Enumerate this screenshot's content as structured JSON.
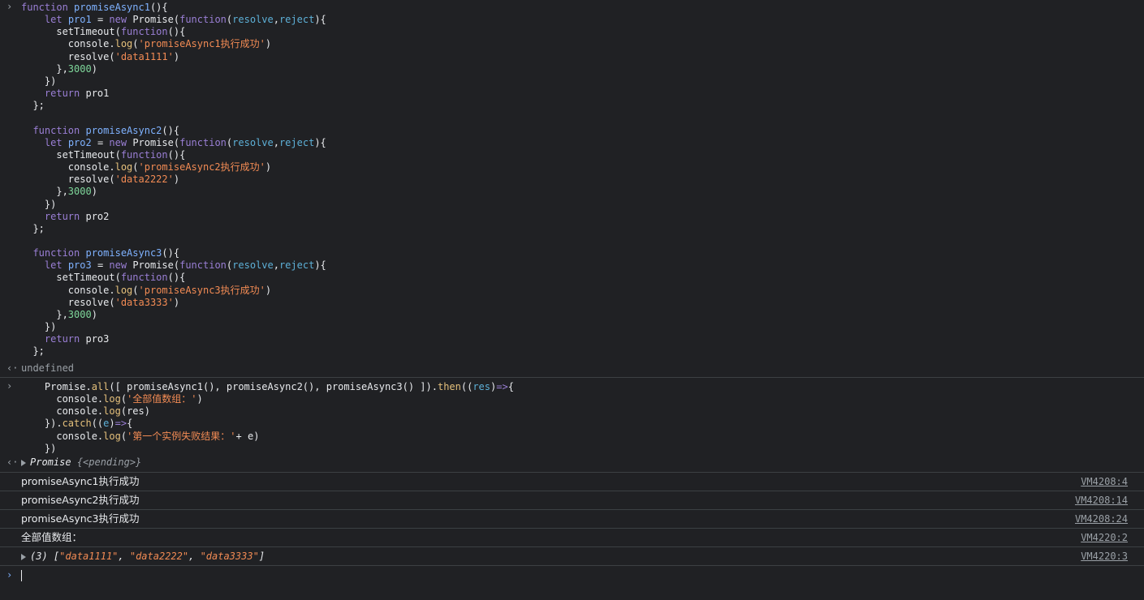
{
  "glyphs": {
    "prompt": "›",
    "result": "‹·"
  },
  "input1": {
    "lines": [
      [
        [
          "kw",
          "function "
        ],
        [
          "fn",
          "promiseAsync1"
        ],
        [
          "prop",
          "(){"
        ]
      ],
      [
        [
          "prop",
          "    "
        ],
        [
          "kw",
          "let "
        ],
        [
          "fn",
          "pro1"
        ],
        [
          "prop",
          " = "
        ],
        [
          "kw",
          "new "
        ],
        [
          "prop",
          "Promise("
        ],
        [
          "kw",
          "function"
        ],
        [
          "prop",
          "("
        ],
        [
          "prm",
          "resolve"
        ],
        [
          "prop",
          ","
        ],
        [
          "prm",
          "reject"
        ],
        [
          "prop",
          "){"
        ]
      ],
      [
        [
          "prop",
          "      setTimeout("
        ],
        [
          "kw",
          "function"
        ],
        [
          "prop",
          "(){"
        ]
      ],
      [
        [
          "prop",
          "        console."
        ],
        [
          "meth",
          "log"
        ],
        [
          "prop",
          "("
        ],
        [
          "str",
          "'promiseAsync1执行成功'"
        ],
        [
          "prop",
          ")"
        ]
      ],
      [
        [
          "prop",
          "        resolve("
        ],
        [
          "str",
          "'data1111'"
        ],
        [
          "prop",
          ")"
        ]
      ],
      [
        [
          "prop",
          "      },"
        ],
        [
          "num",
          "3000"
        ],
        [
          "prop",
          ")"
        ]
      ],
      [
        [
          "prop",
          "    })"
        ]
      ],
      [
        [
          "prop",
          "    "
        ],
        [
          "kw",
          "return "
        ],
        [
          "prop",
          "pro1"
        ]
      ],
      [
        [
          "prop",
          "  };"
        ]
      ],
      [
        [
          "prop",
          ""
        ]
      ],
      [
        [
          "prop",
          "  "
        ],
        [
          "kw",
          "function "
        ],
        [
          "fn",
          "promiseAsync2"
        ],
        [
          "prop",
          "(){"
        ]
      ],
      [
        [
          "prop",
          "    "
        ],
        [
          "kw",
          "let "
        ],
        [
          "fn",
          "pro2"
        ],
        [
          "prop",
          " = "
        ],
        [
          "kw",
          "new "
        ],
        [
          "prop",
          "Promise("
        ],
        [
          "kw",
          "function"
        ],
        [
          "prop",
          "("
        ],
        [
          "prm",
          "resolve"
        ],
        [
          "prop",
          ","
        ],
        [
          "prm",
          "reject"
        ],
        [
          "prop",
          "){"
        ]
      ],
      [
        [
          "prop",
          "      setTimeout("
        ],
        [
          "kw",
          "function"
        ],
        [
          "prop",
          "(){"
        ]
      ],
      [
        [
          "prop",
          "        console."
        ],
        [
          "meth",
          "log"
        ],
        [
          "prop",
          "("
        ],
        [
          "str",
          "'promiseAsync2执行成功'"
        ],
        [
          "prop",
          ")"
        ]
      ],
      [
        [
          "prop",
          "        resolve("
        ],
        [
          "str",
          "'data2222'"
        ],
        [
          "prop",
          ")"
        ]
      ],
      [
        [
          "prop",
          "      },"
        ],
        [
          "num",
          "3000"
        ],
        [
          "prop",
          ")"
        ]
      ],
      [
        [
          "prop",
          "    })"
        ]
      ],
      [
        [
          "prop",
          "    "
        ],
        [
          "kw",
          "return "
        ],
        [
          "prop",
          "pro2"
        ]
      ],
      [
        [
          "prop",
          "  };"
        ]
      ],
      [
        [
          "prop",
          ""
        ]
      ],
      [
        [
          "prop",
          "  "
        ],
        [
          "kw",
          "function "
        ],
        [
          "fn",
          "promiseAsync3"
        ],
        [
          "prop",
          "(){"
        ]
      ],
      [
        [
          "prop",
          "    "
        ],
        [
          "kw",
          "let "
        ],
        [
          "fn",
          "pro3"
        ],
        [
          "prop",
          " = "
        ],
        [
          "kw",
          "new "
        ],
        [
          "prop",
          "Promise("
        ],
        [
          "kw",
          "function"
        ],
        [
          "prop",
          "("
        ],
        [
          "prm",
          "resolve"
        ],
        [
          "prop",
          ","
        ],
        [
          "prm",
          "reject"
        ],
        [
          "prop",
          "){"
        ]
      ],
      [
        [
          "prop",
          "      setTimeout("
        ],
        [
          "kw",
          "function"
        ],
        [
          "prop",
          "(){"
        ]
      ],
      [
        [
          "prop",
          "        console."
        ],
        [
          "meth",
          "log"
        ],
        [
          "prop",
          "("
        ],
        [
          "str",
          "'promiseAsync3执行成功'"
        ],
        [
          "prop",
          ")"
        ]
      ],
      [
        [
          "prop",
          "        resolve("
        ],
        [
          "str",
          "'data3333'"
        ],
        [
          "prop",
          ")"
        ]
      ],
      [
        [
          "prop",
          "      },"
        ],
        [
          "num",
          "3000"
        ],
        [
          "prop",
          ")"
        ]
      ],
      [
        [
          "prop",
          "    })"
        ]
      ],
      [
        [
          "prop",
          "    "
        ],
        [
          "kw",
          "return "
        ],
        [
          "prop",
          "pro3"
        ]
      ],
      [
        [
          "prop",
          "  };"
        ]
      ]
    ]
  },
  "result1": "undefined",
  "input2": {
    "lines": [
      [
        [
          "prop",
          "    Promise."
        ],
        [
          "meth",
          "all"
        ],
        [
          "prop",
          "([ promiseAsync1(), promiseAsync2(), promiseAsync3() ])."
        ],
        [
          "meth",
          "then"
        ],
        [
          "prop",
          "(("
        ],
        [
          "prm",
          "res"
        ],
        [
          "prop",
          ")"
        ],
        [
          "kw",
          "=>"
        ],
        [
          "prop",
          "{"
        ]
      ],
      [
        [
          "prop",
          "      console."
        ],
        [
          "meth",
          "log"
        ],
        [
          "prop",
          "("
        ],
        [
          "str",
          "'全部值数组：'"
        ],
        [
          "prop",
          ")"
        ]
      ],
      [
        [
          "prop",
          "      console."
        ],
        [
          "meth",
          "log"
        ],
        [
          "prop",
          "(res)"
        ]
      ],
      [
        [
          "prop",
          "    })."
        ],
        [
          "meth",
          "catch"
        ],
        [
          "prop",
          "(("
        ],
        [
          "prm",
          "e"
        ],
        [
          "prop",
          ")"
        ],
        [
          "kw",
          "=>"
        ],
        [
          "prop",
          "{"
        ]
      ],
      [
        [
          "prop",
          "      console."
        ],
        [
          "meth",
          "log"
        ],
        [
          "prop",
          "("
        ],
        [
          "str",
          "'第一个实例失败结果：'"
        ],
        [
          "prop",
          "+ e)"
        ]
      ],
      [
        [
          "prop",
          "    })"
        ]
      ]
    ]
  },
  "result2": {
    "label": "Promise",
    "state": "{<pending>}"
  },
  "logs": [
    {
      "text": "promiseAsync1执行成功",
      "source": "VM4208:4"
    },
    {
      "text": "promiseAsync2执行成功",
      "source": "VM4208:14"
    },
    {
      "text": "promiseAsync3执行成功",
      "source": "VM4208:24"
    },
    {
      "text": "全部值数组：",
      "source": "VM4220:2"
    }
  ],
  "array_log": {
    "count": "(3)",
    "open": "[",
    "items": [
      "\"data1111\"",
      "\"data2222\"",
      "\"data3333\""
    ],
    "close": "]",
    "source": "VM4220:3"
  }
}
